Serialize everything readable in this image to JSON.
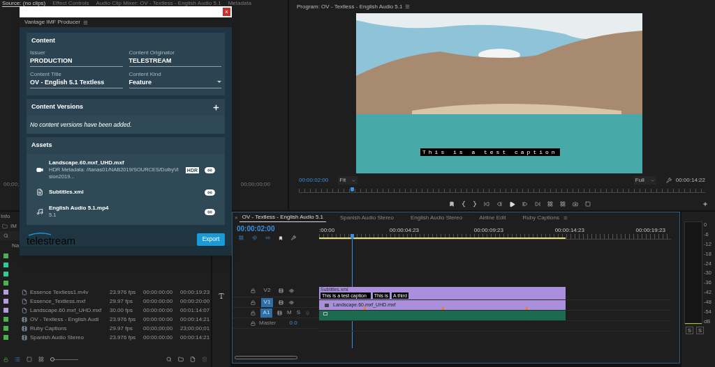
{
  "panel_tabs": [
    {
      "label": "Source: (no clips)",
      "selected": true
    },
    {
      "label": "Effect Controls",
      "selected": false
    },
    {
      "label": "Audio Clip Mixer: OV - Textless - English Audio 5.1",
      "selected": false
    },
    {
      "label": "Metadata",
      "selected": false
    }
  ],
  "source": {
    "timecode_left": "00;00;",
    "timecode_right": "00;00;00;00"
  },
  "program": {
    "title": "Program: OV - Textless - English Audio 5.1",
    "caption": "This is a test caption",
    "timecode": "00:00:02:00",
    "zoom": "Fit",
    "quality": "Full",
    "duration": "00:00:14:22",
    "playhead": {
      "level": 0.13
    }
  },
  "dialog": {
    "close": "x",
    "title": "Vantage IMF Producer",
    "content": {
      "heading": "Content",
      "fields": [
        {
          "label": "Issuer",
          "value": "PRODUCTION",
          "kind": "text"
        },
        {
          "label": "Content Originator",
          "value": "TELESTREAM",
          "kind": "text"
        },
        {
          "label": "Content Title",
          "value": "OV - English 5.1 Textless",
          "kind": "text"
        },
        {
          "label": "Content Kind",
          "value": "Feature",
          "kind": "select"
        }
      ]
    },
    "versions": {
      "heading": "Content Versions",
      "empty": "No content versions have been added."
    },
    "assets": {
      "heading": "Assets",
      "items": [
        {
          "kind": "video",
          "name": "Landscape.60.mxf_UHD.mxf",
          "detail": "HDR Metadata: //tanas01/NAB2019/SOURCES/DolbyVision2019...",
          "badge": "HDR",
          "linked": true
        },
        {
          "kind": "subtitle",
          "name": "Subtitles.xml",
          "linked": true
        },
        {
          "kind": "audio",
          "name": "English Audio 5.1.mp4",
          "detail": "5.1",
          "linked": true
        }
      ]
    },
    "logo": "telestream",
    "export": "Export"
  },
  "project": {
    "tab": "Info",
    "bin": "IM",
    "column_1": "Na",
    "zoom": {
      "level": 0
    },
    "rows": [
      {
        "color": "#4caf50"
      },
      {
        "color": "#2ecc9a"
      },
      {
        "color": "#2ecc9a"
      },
      {
        "color": "#4caf50"
      },
      {
        "color": "#b39ddb",
        "kind": "clip",
        "name": "Essence Textless1.m4v",
        "fps": "23.976 fps",
        "start": "00:00:00:00",
        "end": "00:00:19:23"
      },
      {
        "color": "#b39ddb",
        "kind": "clip",
        "name": "Essence_Textless.mxf",
        "fps": "29.97 fps",
        "start": "00:00:00:00",
        "end": "00:00:20:00"
      },
      {
        "color": "#b39ddb",
        "kind": "clip",
        "name": "Landscape.60.mxf_UHD.mxf",
        "fps": "30.00 fps",
        "start": "00:00:00:00",
        "end": "00:01:14:07"
      },
      {
        "color": "#4caf50",
        "kind": "sequence",
        "name": "OV - Textless - English Audi",
        "fps": "23.976 fps",
        "start": "00:00:00:00",
        "end": "00:00:14:21"
      },
      {
        "color": "#4caf50",
        "kind": "sequence",
        "name": "Ruby Captions",
        "fps": "29.97 fps",
        "start": "00;00;00;00",
        "end": "23;00;00;01"
      },
      {
        "color": "#4caf50",
        "kind": "sequence",
        "name": "Spanish Audio Stereo",
        "fps": "23.976 fps",
        "start": "00:00:00:00",
        "end": "00:00:14:21"
      }
    ]
  },
  "timeline": {
    "close": "×",
    "tabs": [
      {
        "label": "OV - Textless - English Audio 5.1",
        "selected": true
      },
      {
        "label": "Spanish Audio Stereo",
        "selected": false
      },
      {
        "label": "English Audio Stereo",
        "selected": false
      },
      {
        "label": "Airline Edit",
        "selected": false
      },
      {
        "label": "Ruby Captions",
        "selected": false
      }
    ],
    "timecode": "00:00:02:00",
    "ruler": [
      ":00:00",
      "00:00:04:23",
      "00:00:09:23",
      "00:00:14:23",
      "00:00:19:23"
    ],
    "playhead": {
      "level": 0.093
    },
    "tracks": [
      {
        "kind": "video",
        "label": "V2",
        "targeted": false,
        "clip": "Subtitles.xml",
        "captions": [
          "This is a test caption",
          "This is",
          "A third"
        ]
      },
      {
        "kind": "video",
        "label": "V1",
        "targeted": true,
        "clip": "Landscape.60.mxf_UHD.mxf"
      },
      {
        "kind": "audio",
        "label": "A1",
        "targeted": true,
        "mute": "M",
        "solo": "S"
      },
      {
        "kind": "master",
        "label": "Master",
        "value": "0.0"
      }
    ]
  },
  "meter": {
    "scale": [
      "0",
      "-6",
      "-12",
      "-18",
      "-24",
      "-30",
      "-36",
      "-42",
      "-48",
      "-54",
      "dB"
    ],
    "solo": [
      "S",
      "S"
    ]
  }
}
